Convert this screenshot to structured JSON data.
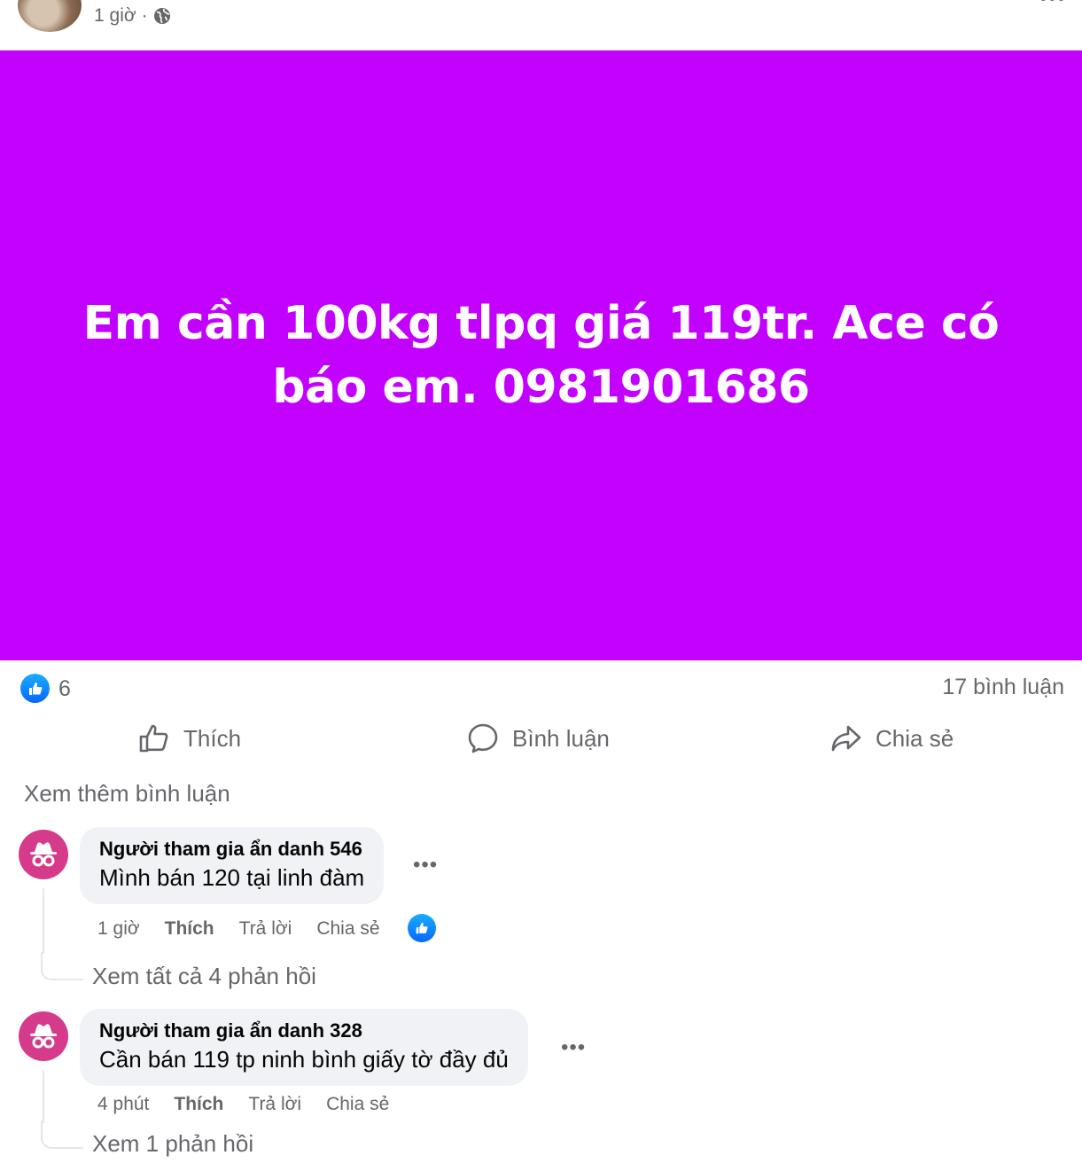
{
  "post": {
    "time": "1 giờ",
    "separator": "·",
    "card_text": "Em cần 100kg tlpq giá 119tr. Ace có báo em. 0981901686",
    "card_color": "#c301fe"
  },
  "stats": {
    "like_count": "6",
    "comments": "17 bình luận"
  },
  "actions": {
    "like": "Thích",
    "comment": "Bình luận",
    "share": "Chia sẻ"
  },
  "comments_section": {
    "see_more": "Xem thêm bình luận",
    "items": [
      {
        "name": "Người tham gia ẩn danh 546",
        "text": "Mình bán 120 tại linh đàm",
        "time": "1 giờ",
        "like": "Thích",
        "reply": "Trả lời",
        "share": "Chia sẻ",
        "replies": "Xem tất cả 4 phản hồi"
      },
      {
        "name": "Người tham gia ẩn danh 328",
        "text": "Cần bán 119 tp ninh bình giấy tờ đầy đủ",
        "time": "4 phút",
        "like": "Thích",
        "reply": "Trả lời",
        "share": "Chia sẻ",
        "replies": "Xem 1 phản hồi"
      }
    ]
  },
  "icons": [
    "globe-icon",
    "more-icon",
    "like-reaction-icon",
    "thumbs-up-icon",
    "comment-icon",
    "share-icon",
    "anonymous-icon"
  ]
}
